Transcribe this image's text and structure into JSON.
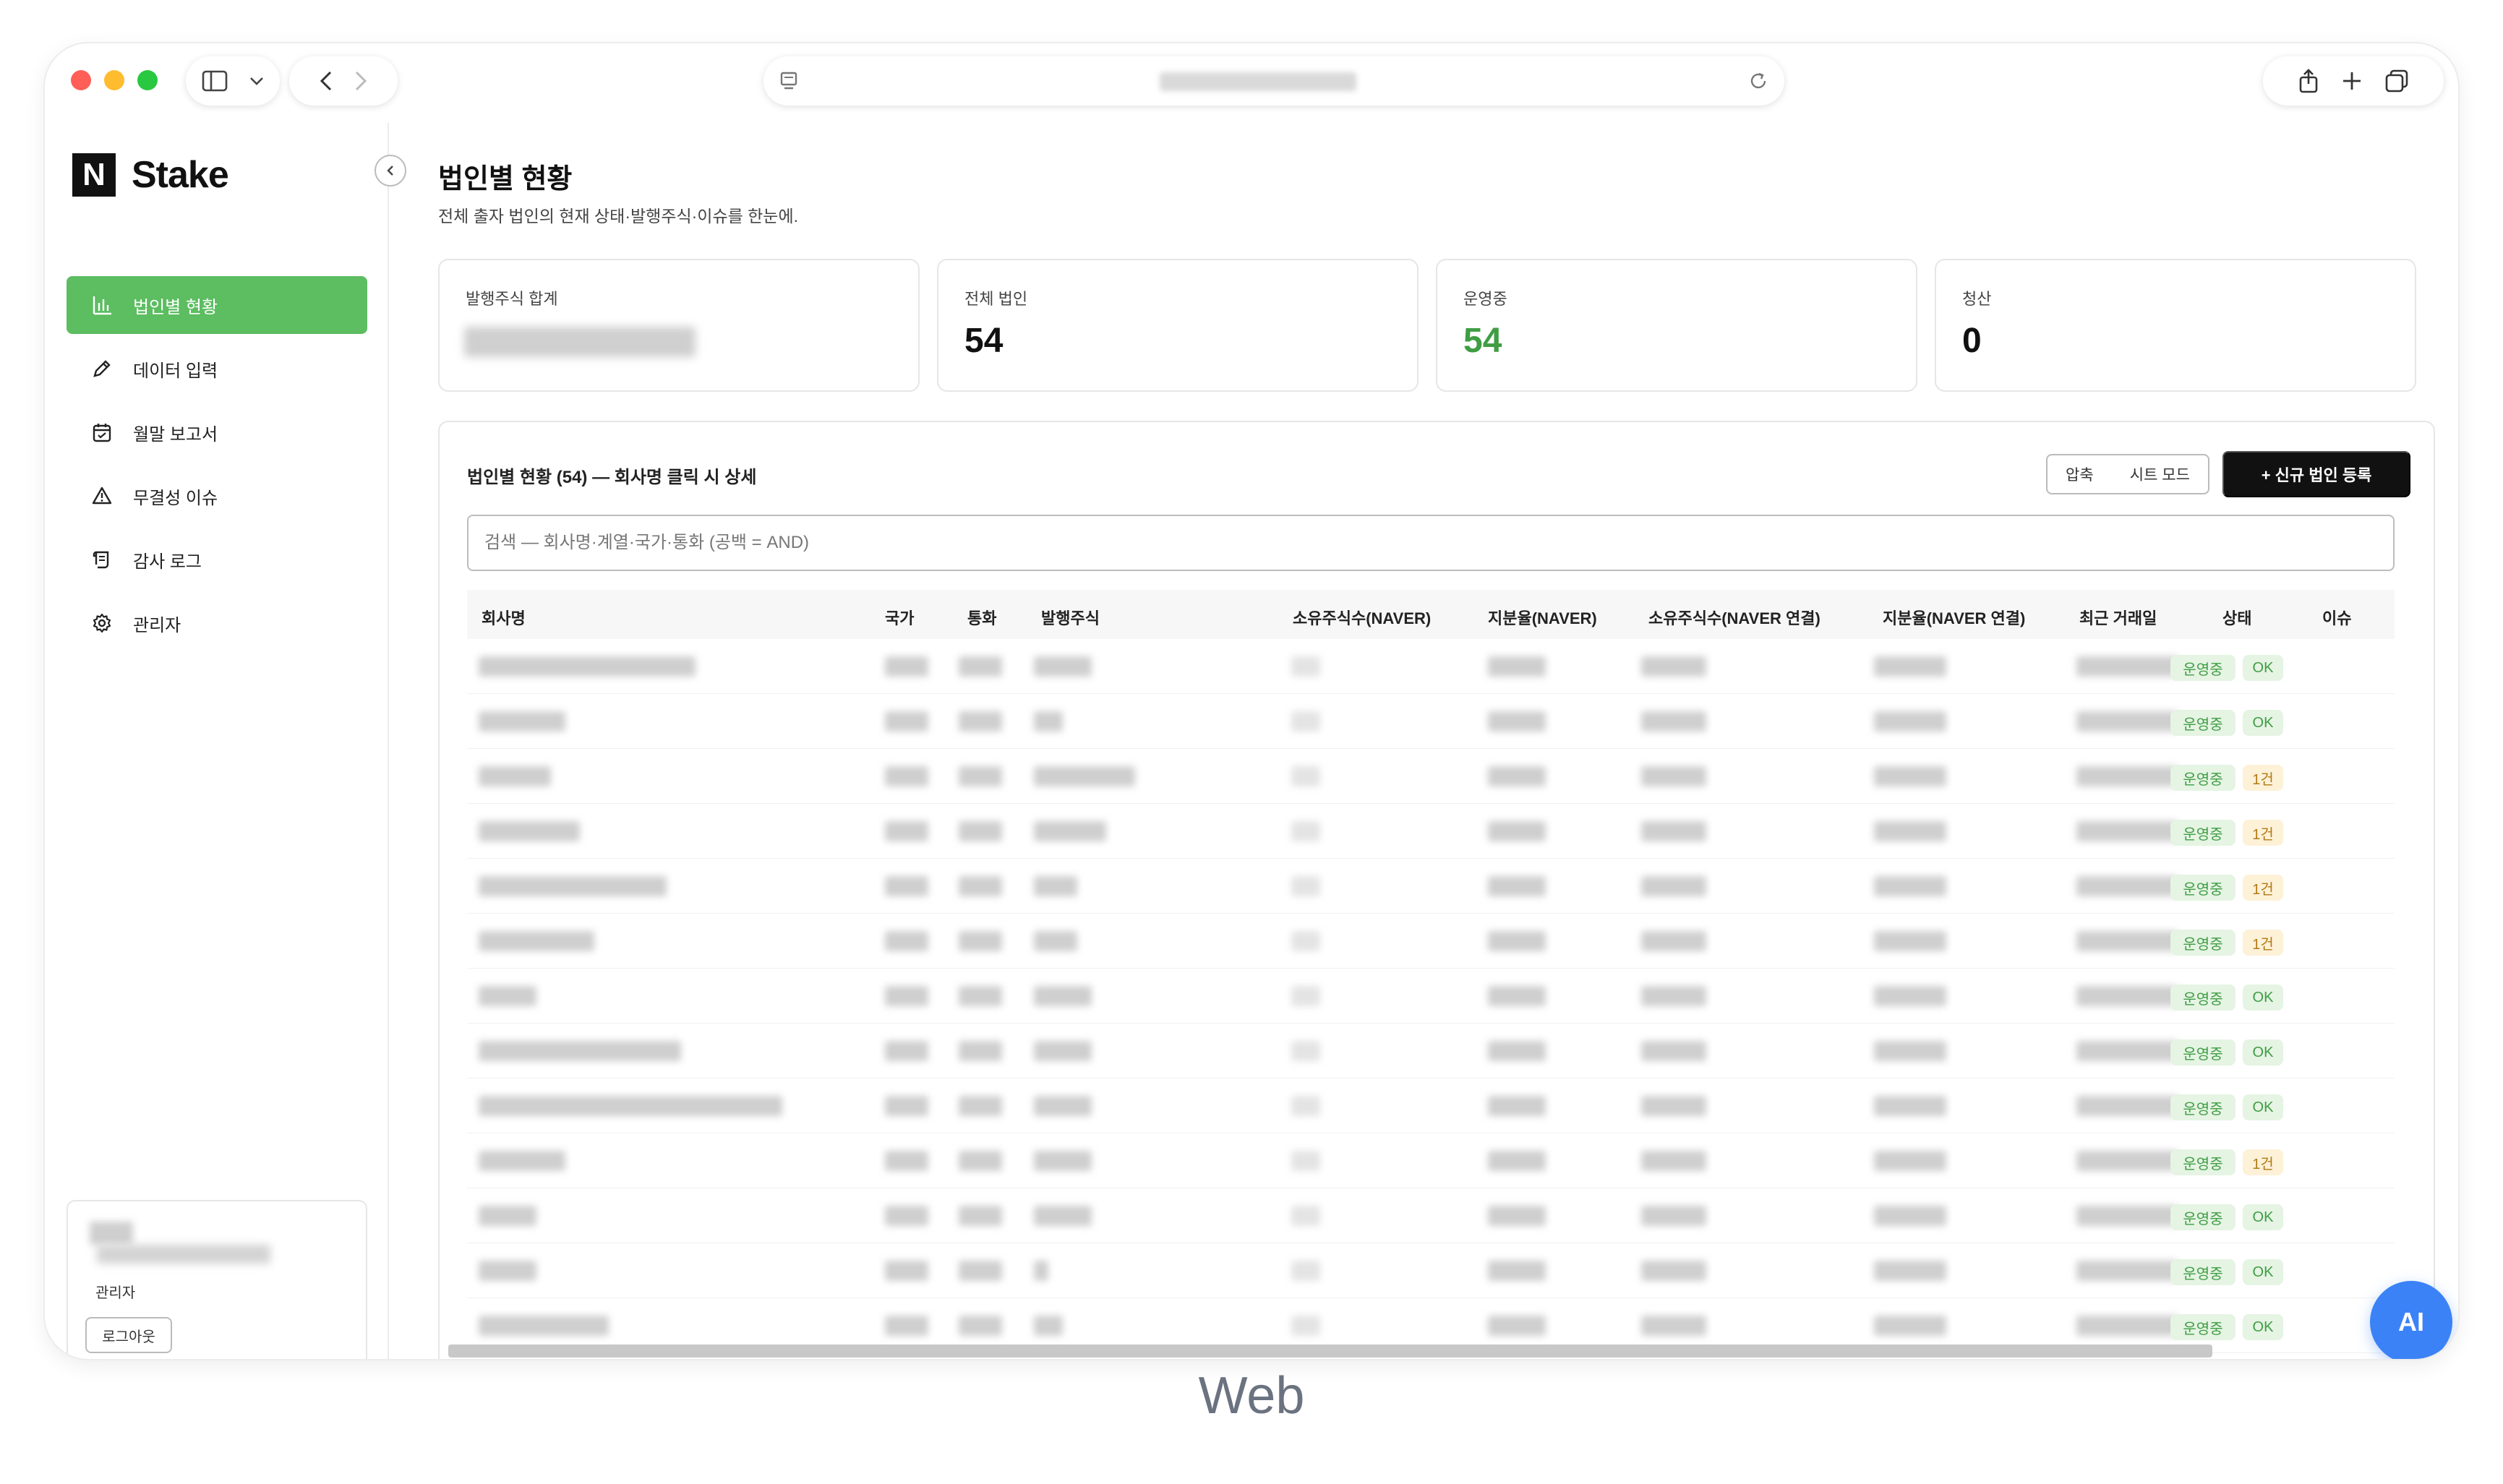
{
  "browser": {
    "icons": [
      "sidebar-toggle-icon",
      "chevron-down-icon",
      "back-icon",
      "forward-icon",
      "page-icon",
      "reload-icon",
      "share-icon",
      "new-tab-icon",
      "tabs-overview-icon"
    ]
  },
  "brand": {
    "mark": "N",
    "name": "Stake"
  },
  "sidebar": {
    "items": [
      {
        "label": "법인별 현황",
        "icon": "bar-chart-icon",
        "active": true
      },
      {
        "label": "데이터 입력",
        "icon": "pencil-icon",
        "active": false
      },
      {
        "label": "월말 보고서",
        "icon": "calendar-icon",
        "active": false
      },
      {
        "label": "무결성 이슈",
        "icon": "warning-icon",
        "active": false
      },
      {
        "label": "감사 로그",
        "icon": "scroll-icon",
        "active": false
      },
      {
        "label": "관리자",
        "icon": "gear-icon",
        "active": false
      }
    ],
    "user": {
      "role": "관리자",
      "logout_label": "로그아웃"
    }
  },
  "page": {
    "title": "법인별 현황",
    "subtitle": "전체 출자 법인의 현재 상태·발행주식·이슈를 한눈에."
  },
  "stats": [
    {
      "label": "발행주식 합계",
      "value": ""
    },
    {
      "label": "전체 법인",
      "value": "54"
    },
    {
      "label": "운영중",
      "value": "54"
    },
    {
      "label": "청산",
      "value": "0"
    }
  ],
  "table_panel": {
    "title": "법인별 현황 (54) — 회사명 클릭 시 상세",
    "toggle_compact": "압축",
    "toggle_sheet": "시트 모드",
    "new_button": "+ 신규 법인 등록",
    "search_placeholder": "검색 — 회사명·계열·국가·통화 (공백 = AND)",
    "columns": [
      "회사명",
      "국가",
      "통화",
      "발행주식",
      "소유주식수(NAVER)",
      "지분율(NAVER)",
      "소유주식수(NAVER 연결)",
      "지분율(NAVER 연결)",
      "최근 거래일",
      "상태",
      "이슈"
    ],
    "rows": [
      {
        "status": "운영중",
        "issue": "OK"
      },
      {
        "status": "운영중",
        "issue": "OK"
      },
      {
        "status": "운영중",
        "issue": "1건"
      },
      {
        "status": "운영중",
        "issue": "1건"
      },
      {
        "status": "운영중",
        "issue": "1건"
      },
      {
        "status": "운영중",
        "issue": "1건"
      },
      {
        "status": "운영중",
        "issue": "OK"
      },
      {
        "status": "운영중",
        "issue": "OK"
      },
      {
        "status": "운영중",
        "issue": "OK"
      },
      {
        "status": "운영중",
        "issue": "1건"
      },
      {
        "status": "운영중",
        "issue": "OK"
      },
      {
        "status": "운영중",
        "issue": "OK"
      },
      {
        "status": "운영중",
        "issue": "OK"
      }
    ]
  },
  "ai_button": "AI",
  "caption": "Web",
  "colors": {
    "accent_green": "#5cbd61",
    "status_green": "#3f9d44",
    "issue_amber": "#b27b15",
    "fab_blue": "#3b82f6"
  }
}
